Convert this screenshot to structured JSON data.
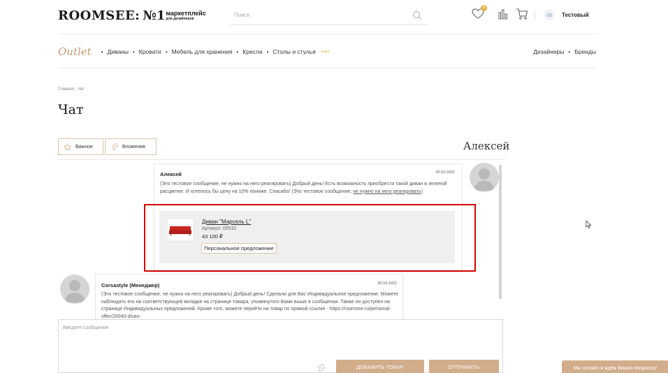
{
  "header": {
    "logo_main": "ROOMSEE:",
    "logo_num": "№1",
    "logo_sub_top": "маркетплейс",
    "logo_sub_bottom": "для дизайнеров",
    "search_placeholder": "Поиск",
    "wishlist_count": "0",
    "user_name": "Тестовый"
  },
  "nav": {
    "outlet": "Outlet",
    "items": [
      "Диваны",
      "Кровати",
      "Мебель для хранения",
      "Кресла",
      "Столы и стулья"
    ],
    "more": "•••",
    "right_items": [
      "Дизайнеры",
      "Бренды"
    ]
  },
  "breadcrumb": "Главная - Чат",
  "page_title": "Чат",
  "filters": {
    "important": "Важное",
    "attachments": "Вложения"
  },
  "contact_name": "Алексей",
  "messages": [
    {
      "author": "Алексей",
      "date": "30.03.2022",
      "text": "(Это тестовое сообщение, не нужно на него реагировать) Добрый день! Есть возможность приобрести такой диван в зеленой расцветке. И хотелось бы цену на 10% пониже. Спасибо! (Это тестовое сообщение, ",
      "text_link": "не нужно на него реагировать)",
      "product": {
        "name": "Диван \"Марсель L\"",
        "sku": "Артикул: 00532",
        "price": "43 100 ₽",
        "tag": "Персональное предложение"
      }
    },
    {
      "author": "Corsastyle (Менеджер)",
      "date": "30.03.2022",
      "text": "(Это тестовое сообщение, не нужно на него реагировать) Добрый день! Сделали для Вас Индивидуальное предложение. Можете наблюдать его на соответствующей вкладке на странице товара, упомянутого Вами выше в сообщении. Также он доступен на странице Индивидуальных предложений. Кроме того, можете перейти на товар по прямой ссылке - https://roomsee.ru/personal-offer/20040-divan-"
    }
  ],
  "composer": {
    "placeholder": "Введите сообщение",
    "add_product": "Добавить товар",
    "send": "Отправить"
  },
  "online_widget": "Мы онлайн и ждём Ваших вопросов!",
  "colors": {
    "accent": "#d2ad8b",
    "outlet": "#c49c73",
    "highlight": "#d40000"
  }
}
